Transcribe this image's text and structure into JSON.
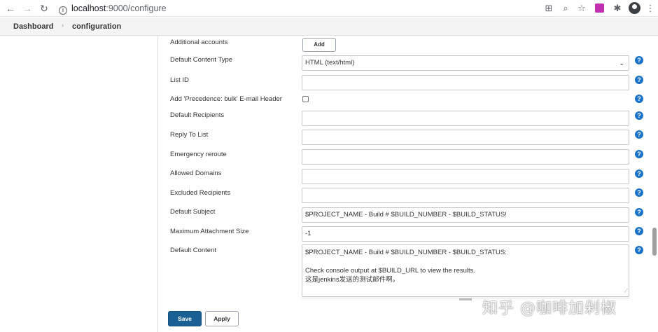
{
  "browser": {
    "url_host": "localhost",
    "url_rest": ":9000/configure"
  },
  "breadcrumb": {
    "items": [
      "Dashboard",
      "configuration"
    ]
  },
  "form": {
    "additional_accounts_label": "Additional accounts",
    "add_button": "Add",
    "default_content_type_label": "Default Content Type",
    "default_content_type_value": "HTML (text/html)",
    "list_id_label": "List ID",
    "list_id_value": "",
    "precedence_label": "Add 'Precedence: bulk' E-mail Header",
    "precedence_checked": false,
    "default_recipients_label": "Default Recipients",
    "default_recipients_value": "",
    "reply_to_label": "Reply To List",
    "reply_to_value": "",
    "emergency_reroute_label": "Emergency reroute",
    "emergency_reroute_value": "",
    "allowed_domains_label": "Allowed Domains",
    "allowed_domains_value": "",
    "excluded_recipients_label": "Excluded Recipients",
    "excluded_recipients_value": "",
    "default_subject_label": "Default Subject",
    "default_subject_value": "$PROJECT_NAME - Build # $BUILD_NUMBER - $BUILD_STATUS!",
    "max_attachment_label": "Maximum Attachment Size",
    "max_attachment_value": "-1",
    "default_content_label": "Default Content",
    "default_content_lines": [
      "$PROJECT_NAME - Build # $BUILD_NUMBER - $BUILD_STATUS:",
      "",
      "Check console output at $BUILD_URL to view the results.",
      "这是jenkins发送的测试邮件啊。"
    ]
  },
  "actions": {
    "save": "Save",
    "apply": "Apply"
  },
  "watermark": "知乎 @咖啡加剁椒",
  "colors": {
    "help_icon": "#1a73c8",
    "save_button": "#1a5f94"
  }
}
